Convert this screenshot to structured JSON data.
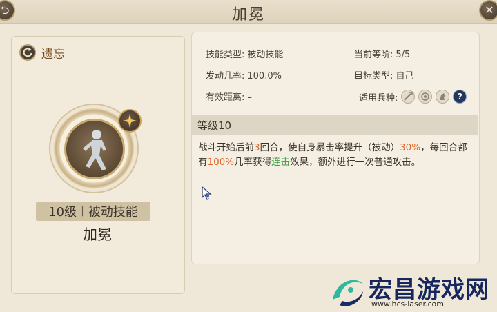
{
  "window": {
    "title": "加冕"
  },
  "left": {
    "forget_label": "遗忘",
    "level_text": "10级",
    "skill_kind": "被动技能",
    "skill_name": "加冕"
  },
  "info": {
    "skill_type_label": "技能类型:",
    "skill_type_value": "被动技能",
    "current_rank_label": "当前等阶:",
    "current_rank_value": "5/5",
    "trigger_rate_label": "发动几率:",
    "trigger_rate_value": "100.0%",
    "target_type_label": "目标类型:",
    "target_type_value": "自己",
    "range_label": "有效距离:",
    "range_value": "–",
    "troops_label": "适用兵种:"
  },
  "level_header": "等级10",
  "description": {
    "p1": "战斗开始后前",
    "n_rounds": "3",
    "p2": "回合，使自身暴击率提升（被动）",
    "crit_pct": "30%",
    "p3": "，每回合都有",
    "chance_pct": "100%",
    "p4": "几率获得",
    "combo": "连击",
    "p5": "效果，额外进行一次普通攻击。"
  },
  "watermark": {
    "title": "宏昌游戏网",
    "url": "www.hcs-laser.com"
  },
  "colors": {
    "highlight_orange": "#e0672a",
    "highlight_green": "#44a64a",
    "watermark_blue": "#17275e"
  }
}
